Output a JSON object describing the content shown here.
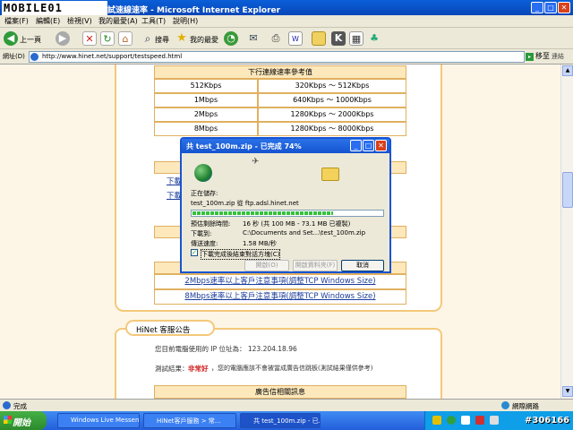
{
  "window": {
    "logo_text": "MOBILE01",
    "title": "試速線速率 - Microsoft Internet Explorer"
  },
  "menu": [
    "檔案(F)",
    "編輯(E)",
    "檢視(V)",
    "我的最愛(A)",
    "工具(T)",
    "說明(H)"
  ],
  "toolbar": {
    "back_label": "上一頁",
    "search_label": "搜尋",
    "favorites_label": "我的最愛"
  },
  "address": {
    "label": "網址(D)",
    "url": "http://www.hinet.net/support/testspeed.html",
    "go_label": "移至",
    "links_label": "連結"
  },
  "speed_table": {
    "header": "下行連線速率參考值",
    "rows": [
      {
        "plan": "512Kbps",
        "range": "320Kbps ～ 512Kbps"
      },
      {
        "plan": "1Mbps",
        "range": "640Kbps ～ 1000Kbps"
      },
      {
        "plan": "2Mbps",
        "range": "1280Kbps ～ 2000Kbps"
      },
      {
        "plan": "8Mbps",
        "range": "1280Kbps ～ 8000Kbps"
      }
    ]
  },
  "page_links": {
    "partial_1": "下載",
    "partial_2": "下載",
    "notice_2m": "2Mbps速率以上客戶注意事項(調整TCP Windows Size)",
    "notice_8m": "8Mbps速率以上客戶注意事項(調整TCP Windows Size)"
  },
  "announcement": {
    "title": "HiNet 客服公告",
    "ip_text": "您目前電腦使用的 IP 位址為： 123.204.18.96",
    "result_label": "測試結果：",
    "result_value": "非常好",
    "result_note": "，您的電腦應該不會被當成廣告信跳板(測試結果僅供參考)",
    "ad_header": "廣告信相關訊息"
  },
  "download_dialog": {
    "title": "共 test_100m.zip - 已完成 74%",
    "saving_label": "正在儲存:",
    "file_line": "test_100m.zip 從 ftp.adsl.hinet.net",
    "progress_percent": 74,
    "time_label": "預估剩餘時間:",
    "time_value": "16 秒 (共 100 MB - 73.1 MB 已複製)",
    "dest_label": "下載到:",
    "dest_value": "C:\\Documents and Set...\\test_100m.zip",
    "rate_label": "傳送速度:",
    "rate_value": "1.58 MB/秒",
    "close_checkbox_label": "下載完成後結束對話方塊(C)",
    "open_button": "開啟(O)",
    "open_folder_button": "開啟資料夾(F)",
    "cancel_button": "取消"
  },
  "status": {
    "text": "完成",
    "zone": "網際網路"
  },
  "taskbar": {
    "start_label": "開始",
    "tasks": [
      "Windows Live Messen...",
      "HiNet客戶服務 > 常...",
      "共 test_100m.zip - 已..."
    ]
  },
  "watermark": "#306166"
}
